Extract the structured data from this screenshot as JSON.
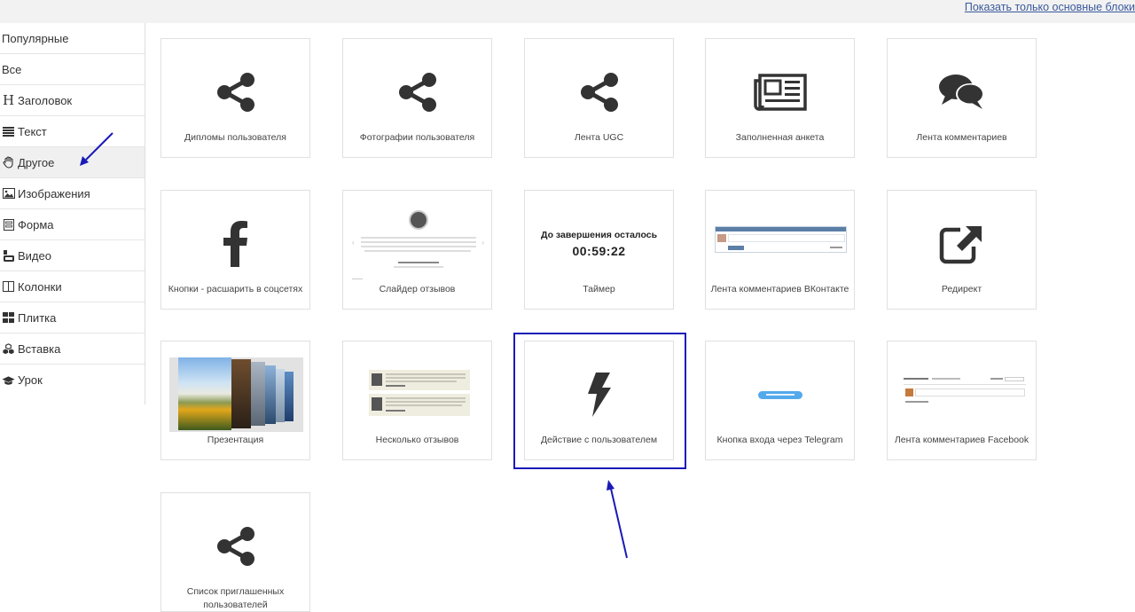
{
  "topbar": {
    "show_basic_link": "Показать только основные блоки"
  },
  "sidebar": {
    "items": [
      {
        "label": "Популярные",
        "icon": "none"
      },
      {
        "label": "Все",
        "icon": "none"
      },
      {
        "label": "Заголовок",
        "icon": "heading-icon",
        "glyph": "H"
      },
      {
        "label": "Текст",
        "icon": "text-lines-icon"
      },
      {
        "label": "Другое",
        "icon": "hand-icon",
        "active": true
      },
      {
        "label": "Изображения",
        "icon": "image-icon"
      },
      {
        "label": "Форма",
        "icon": "form-icon"
      },
      {
        "label": "Видео",
        "icon": "youtube-icon"
      },
      {
        "label": "Колонки",
        "icon": "columns-icon"
      },
      {
        "label": "Плитка",
        "icon": "tiles-icon"
      },
      {
        "label": "Вставка",
        "icon": "cubes-icon"
      },
      {
        "label": "Урок",
        "icon": "graduation-cap-icon"
      }
    ]
  },
  "blocks": [
    {
      "label": "Дипломы пользователя",
      "icon": "share-icon"
    },
    {
      "label": "Фотографии пользователя",
      "icon": "share-icon"
    },
    {
      "label": "Лента UGC",
      "icon": "share-icon"
    },
    {
      "label": "Заполненная анкета",
      "icon": "newspaper-icon"
    },
    {
      "label": "Лента комментариев",
      "icon": "comments-icon"
    },
    {
      "label": "Кнопки - расшарить в соцсетях",
      "icon": "facebook-icon"
    },
    {
      "label": "Слайдер отзывов",
      "icon": "review-slider-preview"
    },
    {
      "label": "Таймер",
      "icon": "timer-preview",
      "timer_title": "До завершения осталось",
      "timer_value": "00:59:22"
    },
    {
      "label": "Лента комментариев ВКонтакте",
      "icon": "vk-comments-preview"
    },
    {
      "label": "Редирект",
      "icon": "external-link-icon"
    },
    {
      "label": "Презентация",
      "icon": "presentation-preview"
    },
    {
      "label": "Несколько отзывов",
      "icon": "reviews-list-preview"
    },
    {
      "label": "Действие с пользователем",
      "icon": "bolt-icon",
      "highlighted": true
    },
    {
      "label": "Кнопка входа через Telegram",
      "icon": "telegram-button-preview"
    },
    {
      "label": "Лента комментариев Facebook",
      "icon": "fb-comments-preview"
    },
    {
      "label": "Список приглашенных пользователей",
      "icon": "share-icon"
    }
  ],
  "colors": {
    "annotation": "#1a1ab8",
    "icon": "#333333",
    "link": "#3a5a9c",
    "active_bg": "#f0f0f0"
  }
}
